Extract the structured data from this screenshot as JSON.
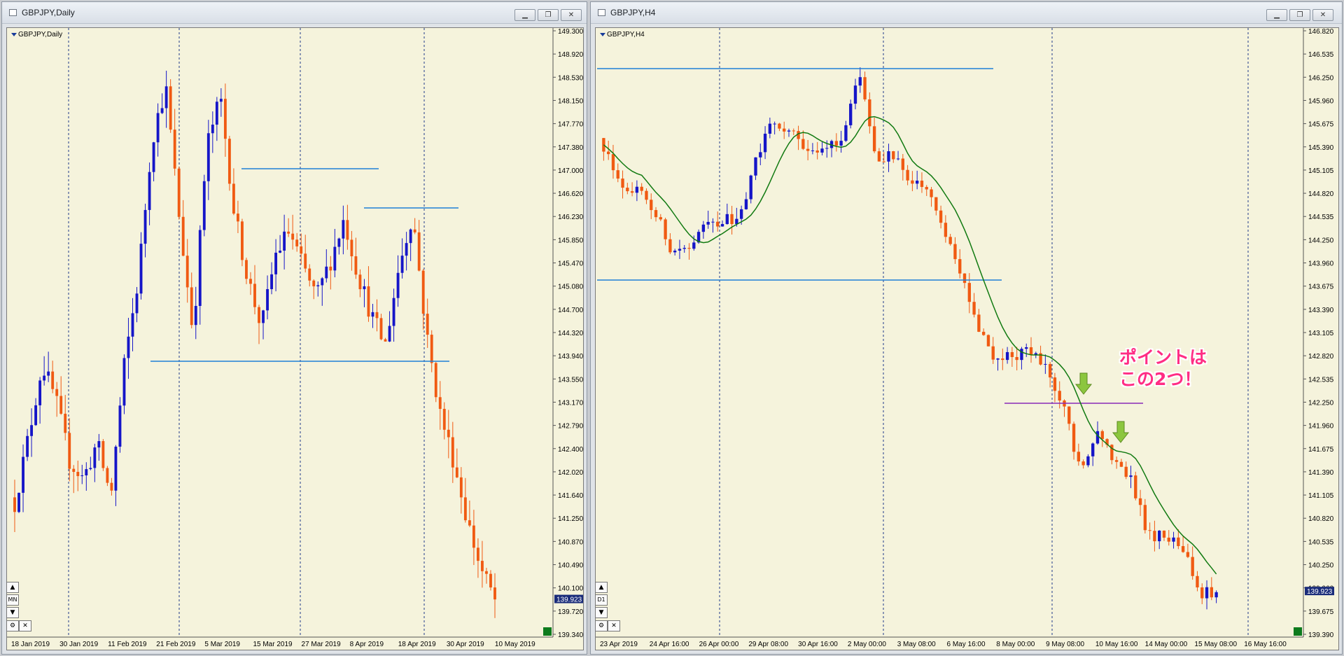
{
  "windows": [
    {
      "id": "daily",
      "title": "GBPJPY,Daily",
      "symbol_label": "GBPJPY,Daily",
      "timeframe_button": "MN",
      "price_axis": [
        "149.300",
        "148.920",
        "148.530",
        "148.150",
        "147.770",
        "147.380",
        "147.000",
        "146.620",
        "146.230",
        "145.850",
        "145.470",
        "145.080",
        "144.700",
        "144.320",
        "143.940",
        "143.550",
        "143.170",
        "142.790",
        "142.400",
        "142.020",
        "141.640",
        "141.250",
        "140.870",
        "140.490",
        "140.100",
        "139.720",
        "139.340"
      ],
      "current_price": "139.923",
      "time_axis": [
        "18 Jan 2019",
        "30 Jan 2019",
        "11 Feb 2019",
        "21 Feb 2019",
        "5 Mar 2019",
        "15 Mar 2019",
        "27 Mar 2019",
        "8 Apr 2019",
        "18 Apr 2019",
        "30 Apr 2019",
        "10 May 2019"
      ]
    },
    {
      "id": "h4",
      "title": "GBPJPY,H4",
      "symbol_label": "GBPJPY,H4",
      "timeframe_button": "D1",
      "price_axis": [
        "146.820",
        "146.535",
        "146.250",
        "145.960",
        "145.675",
        "145.390",
        "145.105",
        "144.820",
        "144.535",
        "144.250",
        "143.960",
        "143.675",
        "143.390",
        "143.105",
        "142.820",
        "142.535",
        "142.250",
        "141.960",
        "141.675",
        "141.390",
        "141.105",
        "140.820",
        "140.535",
        "140.250",
        "139.960",
        "139.675",
        "139.390"
      ],
      "current_price": "139.923",
      "time_axis": [
        "23 Apr 2019",
        "24 Apr 16:00",
        "26 Apr 00:00",
        "29 Apr 08:00",
        "30 Apr 16:00",
        "2 May 00:00",
        "3 May 08:00",
        "6 May 16:00",
        "8 May 00:00",
        "9 May 08:00",
        "10 May 16:00",
        "14 May 00:00",
        "15 May 08:00",
        "16 May 16:00"
      ],
      "annotation": [
        "ポイントは",
        "この2つ！"
      ]
    }
  ],
  "colors": {
    "bull": "#1515c8",
    "bear": "#f05a12",
    "chart_bg": "#f5f3dc",
    "hline": "#1f7fd6",
    "support_line": "#8a2bb8",
    "moving_average": "#117a11",
    "arrow": "#8cc63f",
    "annotation_text": "#ff2d84"
  }
}
